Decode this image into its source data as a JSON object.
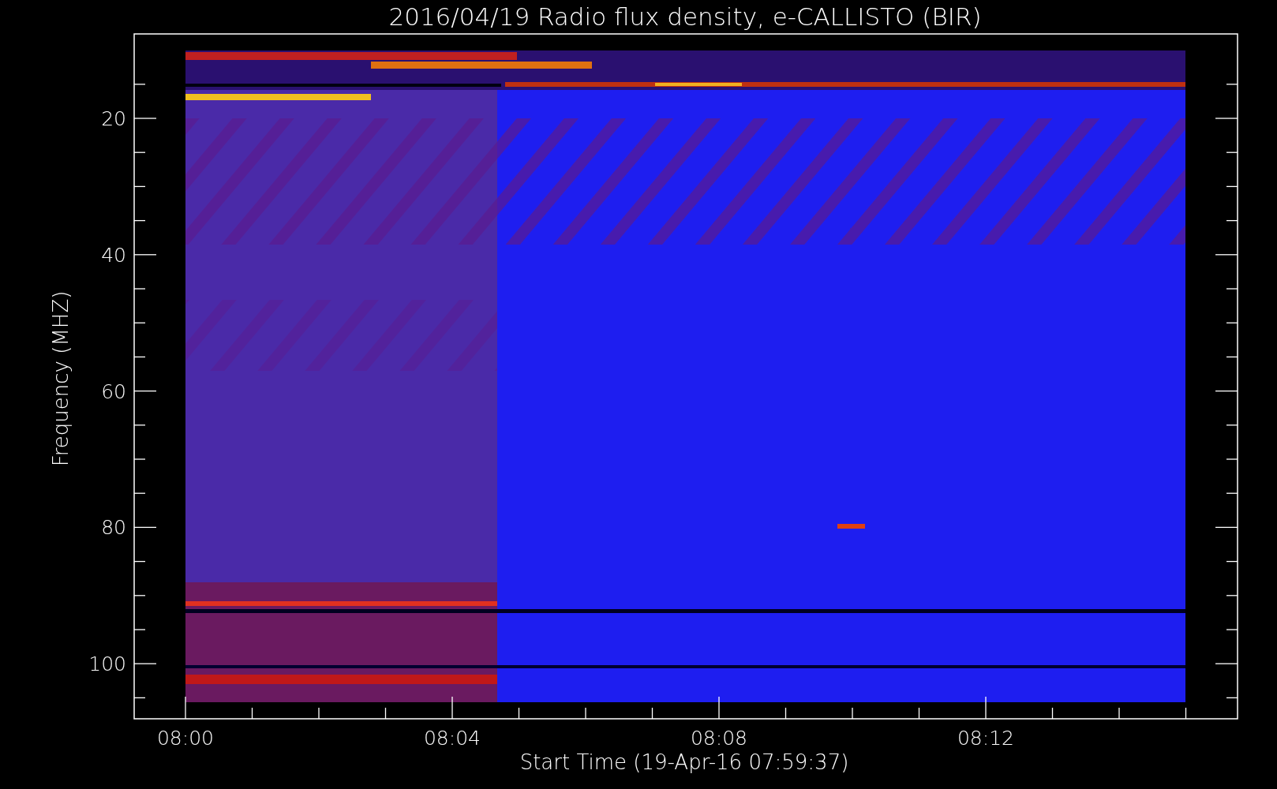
{
  "title": "2016/04/19  Radio flux density, e-CALLISTO (BIR)",
  "y_axis": {
    "label": "Frequency (MHZ)",
    "ticks": [
      "20",
      "40",
      "60",
      "80",
      "100"
    ]
  },
  "x_axis": {
    "label": "Start Time (19-Apr-16 07:59:37)",
    "ticks": [
      "08:00",
      "08:04",
      "08:08",
      "08:12"
    ]
  }
}
